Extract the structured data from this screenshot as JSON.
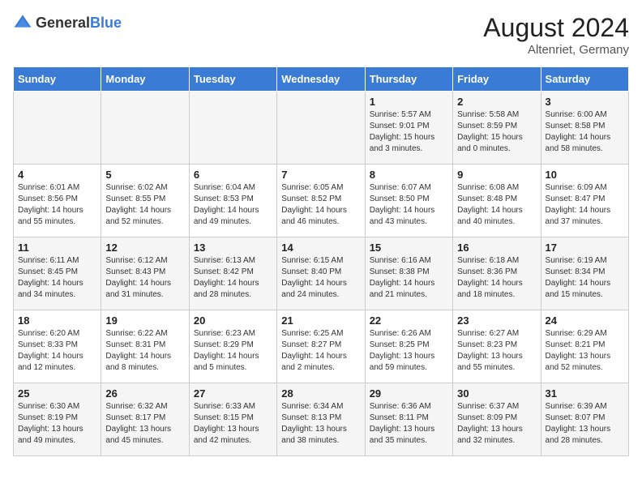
{
  "header": {
    "logo_general": "General",
    "logo_blue": "Blue",
    "month_year": "August 2024",
    "location": "Altenriet, Germany"
  },
  "weekdays": [
    "Sunday",
    "Monday",
    "Tuesday",
    "Wednesday",
    "Thursday",
    "Friday",
    "Saturday"
  ],
  "weeks": [
    [
      {
        "day": "",
        "sunrise": "",
        "sunset": "",
        "daylight": ""
      },
      {
        "day": "",
        "sunrise": "",
        "sunset": "",
        "daylight": ""
      },
      {
        "day": "",
        "sunrise": "",
        "sunset": "",
        "daylight": ""
      },
      {
        "day": "",
        "sunrise": "",
        "sunset": "",
        "daylight": ""
      },
      {
        "day": "1",
        "sunrise": "Sunrise: 5:57 AM",
        "sunset": "Sunset: 9:01 PM",
        "daylight": "Daylight: 15 hours and 3 minutes."
      },
      {
        "day": "2",
        "sunrise": "Sunrise: 5:58 AM",
        "sunset": "Sunset: 8:59 PM",
        "daylight": "Daylight: 15 hours and 0 minutes."
      },
      {
        "day": "3",
        "sunrise": "Sunrise: 6:00 AM",
        "sunset": "Sunset: 8:58 PM",
        "daylight": "Daylight: 14 hours and 58 minutes."
      }
    ],
    [
      {
        "day": "4",
        "sunrise": "Sunrise: 6:01 AM",
        "sunset": "Sunset: 8:56 PM",
        "daylight": "Daylight: 14 hours and 55 minutes."
      },
      {
        "day": "5",
        "sunrise": "Sunrise: 6:02 AM",
        "sunset": "Sunset: 8:55 PM",
        "daylight": "Daylight: 14 hours and 52 minutes."
      },
      {
        "day": "6",
        "sunrise": "Sunrise: 6:04 AM",
        "sunset": "Sunset: 8:53 PM",
        "daylight": "Daylight: 14 hours and 49 minutes."
      },
      {
        "day": "7",
        "sunrise": "Sunrise: 6:05 AM",
        "sunset": "Sunset: 8:52 PM",
        "daylight": "Daylight: 14 hours and 46 minutes."
      },
      {
        "day": "8",
        "sunrise": "Sunrise: 6:07 AM",
        "sunset": "Sunset: 8:50 PM",
        "daylight": "Daylight: 14 hours and 43 minutes."
      },
      {
        "day": "9",
        "sunrise": "Sunrise: 6:08 AM",
        "sunset": "Sunset: 8:48 PM",
        "daylight": "Daylight: 14 hours and 40 minutes."
      },
      {
        "day": "10",
        "sunrise": "Sunrise: 6:09 AM",
        "sunset": "Sunset: 8:47 PM",
        "daylight": "Daylight: 14 hours and 37 minutes."
      }
    ],
    [
      {
        "day": "11",
        "sunrise": "Sunrise: 6:11 AM",
        "sunset": "Sunset: 8:45 PM",
        "daylight": "Daylight: 14 hours and 34 minutes."
      },
      {
        "day": "12",
        "sunrise": "Sunrise: 6:12 AM",
        "sunset": "Sunset: 8:43 PM",
        "daylight": "Daylight: 14 hours and 31 minutes."
      },
      {
        "day": "13",
        "sunrise": "Sunrise: 6:13 AM",
        "sunset": "Sunset: 8:42 PM",
        "daylight": "Daylight: 14 hours and 28 minutes."
      },
      {
        "day": "14",
        "sunrise": "Sunrise: 6:15 AM",
        "sunset": "Sunset: 8:40 PM",
        "daylight": "Daylight: 14 hours and 24 minutes."
      },
      {
        "day": "15",
        "sunrise": "Sunrise: 6:16 AM",
        "sunset": "Sunset: 8:38 PM",
        "daylight": "Daylight: 14 hours and 21 minutes."
      },
      {
        "day": "16",
        "sunrise": "Sunrise: 6:18 AM",
        "sunset": "Sunset: 8:36 PM",
        "daylight": "Daylight: 14 hours and 18 minutes."
      },
      {
        "day": "17",
        "sunrise": "Sunrise: 6:19 AM",
        "sunset": "Sunset: 8:34 PM",
        "daylight": "Daylight: 14 hours and 15 minutes."
      }
    ],
    [
      {
        "day": "18",
        "sunrise": "Sunrise: 6:20 AM",
        "sunset": "Sunset: 8:33 PM",
        "daylight": "Daylight: 14 hours and 12 minutes."
      },
      {
        "day": "19",
        "sunrise": "Sunrise: 6:22 AM",
        "sunset": "Sunset: 8:31 PM",
        "daylight": "Daylight: 14 hours and 8 minutes."
      },
      {
        "day": "20",
        "sunrise": "Sunrise: 6:23 AM",
        "sunset": "Sunset: 8:29 PM",
        "daylight": "Daylight: 14 hours and 5 minutes."
      },
      {
        "day": "21",
        "sunrise": "Sunrise: 6:25 AM",
        "sunset": "Sunset: 8:27 PM",
        "daylight": "Daylight: 14 hours and 2 minutes."
      },
      {
        "day": "22",
        "sunrise": "Sunrise: 6:26 AM",
        "sunset": "Sunset: 8:25 PM",
        "daylight": "Daylight: 13 hours and 59 minutes."
      },
      {
        "day": "23",
        "sunrise": "Sunrise: 6:27 AM",
        "sunset": "Sunset: 8:23 PM",
        "daylight": "Daylight: 13 hours and 55 minutes."
      },
      {
        "day": "24",
        "sunrise": "Sunrise: 6:29 AM",
        "sunset": "Sunset: 8:21 PM",
        "daylight": "Daylight: 13 hours and 52 minutes."
      }
    ],
    [
      {
        "day": "25",
        "sunrise": "Sunrise: 6:30 AM",
        "sunset": "Sunset: 8:19 PM",
        "daylight": "Daylight: 13 hours and 49 minutes."
      },
      {
        "day": "26",
        "sunrise": "Sunrise: 6:32 AM",
        "sunset": "Sunset: 8:17 PM",
        "daylight": "Daylight: 13 hours and 45 minutes."
      },
      {
        "day": "27",
        "sunrise": "Sunrise: 6:33 AM",
        "sunset": "Sunset: 8:15 PM",
        "daylight": "Daylight: 13 hours and 42 minutes."
      },
      {
        "day": "28",
        "sunrise": "Sunrise: 6:34 AM",
        "sunset": "Sunset: 8:13 PM",
        "daylight": "Daylight: 13 hours and 38 minutes."
      },
      {
        "day": "29",
        "sunrise": "Sunrise: 6:36 AM",
        "sunset": "Sunset: 8:11 PM",
        "daylight": "Daylight: 13 hours and 35 minutes."
      },
      {
        "day": "30",
        "sunrise": "Sunrise: 6:37 AM",
        "sunset": "Sunset: 8:09 PM",
        "daylight": "Daylight: 13 hours and 32 minutes."
      },
      {
        "day": "31",
        "sunrise": "Sunrise: 6:39 AM",
        "sunset": "Sunset: 8:07 PM",
        "daylight": "Daylight: 13 hours and 28 minutes."
      }
    ]
  ]
}
